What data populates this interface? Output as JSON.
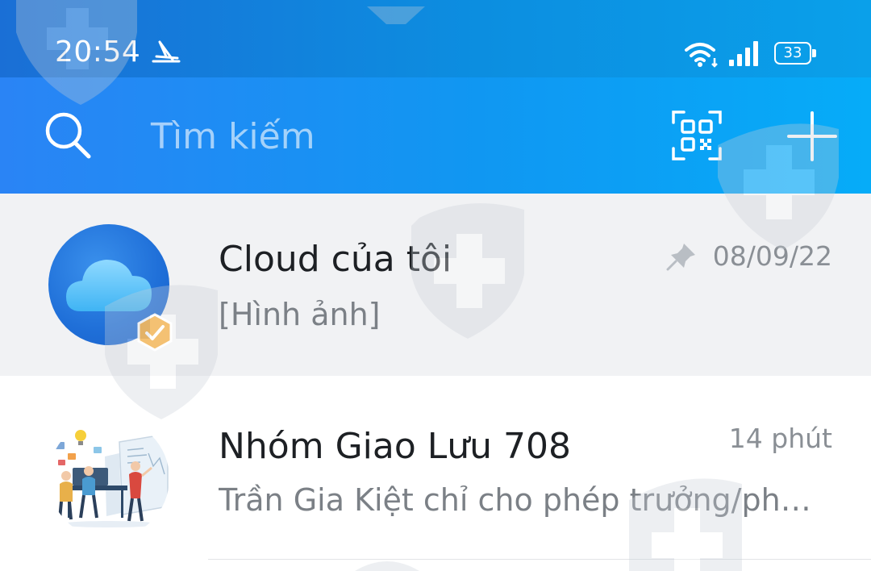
{
  "status_bar": {
    "time": "20:54",
    "battery": "33",
    "icons": [
      "app-notification-icon",
      "wifi-icon",
      "signal-icon",
      "battery-icon"
    ]
  },
  "header": {
    "search_placeholder": "Tìm kiếm",
    "icons": [
      "search-icon",
      "qr-code-icon",
      "plus-icon"
    ]
  },
  "conversations": [
    {
      "name": "Cloud của tôi",
      "preview": "[Hình ảnh]",
      "time": "08/09/22",
      "pinned": true,
      "avatar": "cloud-icon",
      "verified": true
    },
    {
      "name": "Nhóm Giao Lưu 708",
      "preview": "Trần Gia Kiệt chỉ cho phép trưởng/phó...",
      "time": "14 phút",
      "pinned": false,
      "avatar": "group-illustration"
    }
  ],
  "colors": {
    "header_start": "#2a84f5",
    "header_end": "#06acf8",
    "badge": "#f0a431",
    "pinned_bg": "#f1f2f4"
  }
}
